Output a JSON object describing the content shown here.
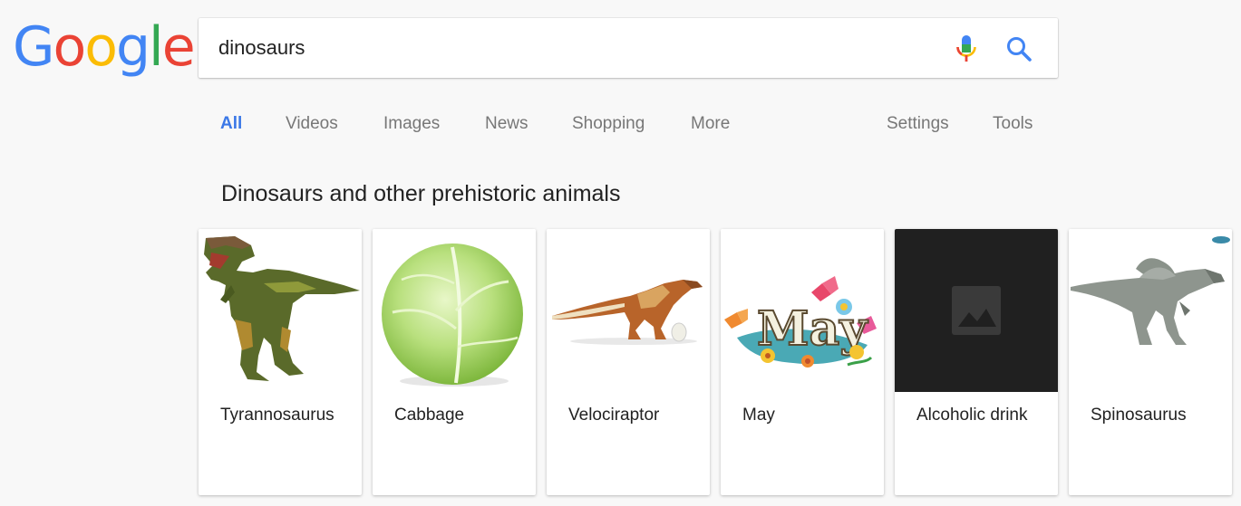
{
  "logo": {
    "letters": [
      "G",
      "o",
      "o",
      "g",
      "l",
      "e"
    ],
    "colors": [
      "#4285f4",
      "#ea4335",
      "#fbbc05",
      "#4285f4",
      "#34a853",
      "#ea4335"
    ]
  },
  "search": {
    "value": "dinosaurs",
    "mic_icon": "microphone-icon",
    "search_icon": "magnifier-icon"
  },
  "tabs": {
    "items": [
      {
        "label": "All",
        "active": true
      },
      {
        "label": "Videos"
      },
      {
        "label": "Images"
      },
      {
        "label": "News"
      },
      {
        "label": "Shopping"
      },
      {
        "label": "More"
      }
    ],
    "right": [
      {
        "label": "Settings"
      },
      {
        "label": "Tools"
      }
    ]
  },
  "section": {
    "title": "Dinosaurs and other prehistoric animals"
  },
  "cards": [
    {
      "label": "Tyrannosaurus",
      "icon": "tyrannosaurus-image"
    },
    {
      "label": "Cabbage",
      "icon": "cabbage-image"
    },
    {
      "label": "Velociraptor",
      "icon": "velociraptor-image"
    },
    {
      "label": "May",
      "icon": "may-clipart-image"
    },
    {
      "label": "Alcoholic drink",
      "icon": "image-placeholder-icon"
    },
    {
      "label": "Spinosaurus",
      "icon": "spinosaurus-image"
    }
  ],
  "accent": "#3b78e7"
}
